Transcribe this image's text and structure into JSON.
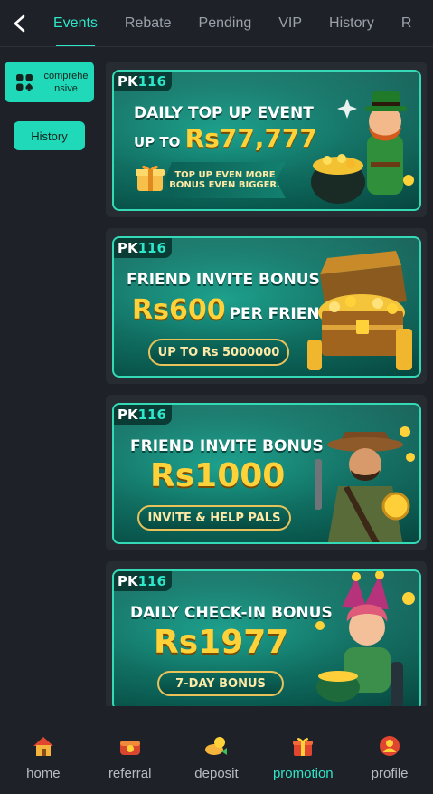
{
  "header": {
    "back_icon": "chevron-left-icon",
    "tabs": [
      {
        "label": "Events",
        "active": true
      },
      {
        "label": "Rebate",
        "active": false
      },
      {
        "label": "Pending",
        "active": false
      },
      {
        "label": "VIP",
        "active": false
      },
      {
        "label": "History",
        "active": false
      },
      {
        "label": "R",
        "active": false
      }
    ]
  },
  "sidebar": {
    "category": {
      "icon": "grid-spade-icon",
      "label": "comprehensive"
    },
    "history_button": "History"
  },
  "banners": [
    {
      "brand": {
        "a": "PK",
        "b": "116"
      },
      "line1": "DAILY TOP UP EVENT",
      "line2a": "UP TO ",
      "line2b": "Rs77,777",
      "line3": "TOP UP EVEN MORE",
      "line4": "BONUS EVEN BIGGER!",
      "art": "leprechaun-gold-pot"
    },
    {
      "brand": {
        "a": "PK",
        "b": "116"
      },
      "line1": "FRIEND INVITE BONUS",
      "line2a": "Rs600",
      "line2b": "PER FRIEND",
      "pill": "UP TO Rs 5000000",
      "art": "treasure-chest"
    },
    {
      "brand": {
        "a": "PK",
        "b": "116"
      },
      "line1": "FRIEND INVITE BONUS",
      "line2": "Rs1000",
      "pill": "INVITE & HELP PALS",
      "art": "explorer-with-coin"
    },
    {
      "brand": {
        "a": "PK",
        "b": "116"
      },
      "line1": "DAILY CHECK-IN BONUS",
      "line2": "Rs1977",
      "pill": "7-DAY BONUS",
      "art": "jester-with-hat"
    }
  ],
  "bottom_nav": [
    {
      "label": "home",
      "icon": "home-icon",
      "active": false
    },
    {
      "label": "referral",
      "icon": "referral-icon",
      "active": false
    },
    {
      "label": "deposit",
      "icon": "deposit-icon",
      "active": false
    },
    {
      "label": "promotion",
      "icon": "gift-icon",
      "active": true
    },
    {
      "label": "profile",
      "icon": "profile-icon",
      "active": false
    }
  ],
  "colors": {
    "accent": "#2ee6c8",
    "background": "#1e2228",
    "card": "#272c33"
  }
}
